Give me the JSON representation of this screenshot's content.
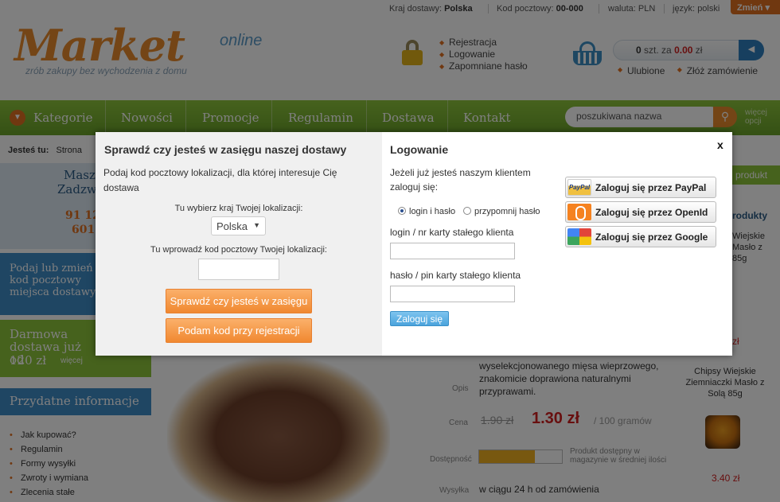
{
  "topbar": {
    "country_label": "Kraj dostawy:",
    "country_value": "Polska",
    "postal_label": "Kod pocztowy:",
    "postal_value": "00-000",
    "currency_label": "waluta:",
    "currency_value": "PLN",
    "language_label": "język:",
    "language_value": "polski",
    "change_label": "Zmień"
  },
  "logo": {
    "name": "Market",
    "suffix": "online",
    "slogan": "zrób zakupy bez wychodzenia z domu"
  },
  "account_links": [
    "Rejestracja",
    "Logowanie",
    "Zapomniane hasło"
  ],
  "cart": {
    "count": "0",
    "count_unit": "szt. za",
    "amount": "0.00",
    "currency": "zł",
    "links": [
      "Ulubione",
      "Złóż zamówienie"
    ]
  },
  "nav": {
    "items": [
      "Kategorie",
      "Nowości",
      "Promocje",
      "Regulamin",
      "Dostawa",
      "Kontakt"
    ],
    "search_placeholder": "poszukiwana nazwa",
    "more_options_1": "więcej",
    "more_options_2": "opcji"
  },
  "breadcrumb": {
    "label": "Jesteś tu:",
    "first": "Strona"
  },
  "sidebar": {
    "contact_heading_1": "Masz",
    "contact_heading_2": "Zadzwo",
    "phone_1": "91 12",
    "phone_2": "601",
    "postal_promo": "Podaj lub zmień kod pocztowy miejsca dostawy",
    "free_delivery": "Darmowa dostawa już od",
    "free_delivery_amount": "120 zł",
    "more_link": "więcej",
    "info_heading": "Przydatne informacje",
    "info_items": [
      "Jak kupować?",
      "Regulamin",
      "Formy wysyłki",
      "Zwroty i wymiana",
      "Zlecenia stałe"
    ]
  },
  "right_col": {
    "heading": "produkt",
    "sub": "rodukty",
    "item_1_line_1": "Wiejskie",
    "item_1_line_2": "Masło z",
    "item_1_line_3": "85g",
    "item_1_price": "zł"
  },
  "product": {
    "desc_label": "Opis",
    "description": "wyselekcjonowanego mięsa wieprzowego, znakomicie doprawiona naturalnymi przyprawami.",
    "price_label": "Cena",
    "old_price": "1.90 zł",
    "new_price": "1.30 zł",
    "per_unit": "/ 100 gramów",
    "availability_label": "Dostępność",
    "availability_fraction": 0.67,
    "availability_note": "Produkt dostępny w magazynie w średniej ilości",
    "shipping_label": "Wysyłka",
    "shipping_value": "w ciągu 24 h od zamówienia",
    "side_product_name": "Chipsy Wiejskie Ziemniaczki Masło z Solą 85g",
    "side_product_price": "3.40 zł"
  },
  "modal": {
    "left": {
      "title": "Sprawdź czy jesteś w zasięgu naszej dostawy",
      "intro": "Podaj kod pocztowy lokalizacji, dla której interesuje Cię dostawa",
      "country_label": "Tu wybierz kraj Twojej lokalizacji:",
      "country_value": "Polska",
      "postal_label": "Tu wprowadź kod pocztowy Twojej lokalizacji:",
      "postal_value": "",
      "check_button": "Sprawdź czy jesteś w zasięgu",
      "register_button": "Podam kod przy rejestracji"
    },
    "right": {
      "title": "Logowanie",
      "close": "x",
      "intro": "Jeżeli już jesteś naszym klientem zaloguj się:",
      "radio_login": "login i hasło",
      "radio_remind": "przypomnij hasło",
      "login_label": "login / nr karty stałego klienta",
      "login_value": "",
      "password_label": "hasło / pin karty stałego klienta",
      "password_value": "",
      "submit": "Zaloguj się",
      "paypal_icon_text": "PayPal",
      "paypal": "Zaloguj się przez PayPal",
      "openid": "Zaloguj się przez OpenId",
      "google": "Zaloguj się przez Google"
    }
  },
  "colors": {
    "accent_orange": "#e07020",
    "nav_green": "#7ab532",
    "blue": "#3f8cc7",
    "price_red": "#d01e1e"
  }
}
